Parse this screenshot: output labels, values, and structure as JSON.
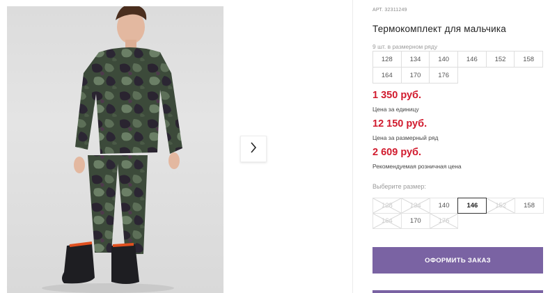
{
  "product": {
    "article": "АРТ. 32311249",
    "title": "Термокомплект для мальчика",
    "series_label": "9 шт. в размерном ряду",
    "series_sizes": [
      "128",
      "134",
      "140",
      "146",
      "152",
      "158",
      "164",
      "170",
      "176"
    ]
  },
  "prices": {
    "unit": {
      "value": "1 350 руб.",
      "note": "Цена за единицу"
    },
    "series": {
      "value": "12 150 руб.",
      "note": "Цена за размерный ряд"
    },
    "retail": {
      "value": "2 609 руб.",
      "note": "Рекомендуемая розничная цена"
    }
  },
  "size_picker": {
    "label": "Выберите размер:",
    "options": [
      {
        "label": "128",
        "available": false,
        "selected": false
      },
      {
        "label": "134",
        "available": false,
        "selected": false
      },
      {
        "label": "140",
        "available": true,
        "selected": false
      },
      {
        "label": "146",
        "available": true,
        "selected": true
      },
      {
        "label": "152",
        "available": false,
        "selected": false
      },
      {
        "label": "158",
        "available": true,
        "selected": false
      },
      {
        "label": "164",
        "available": false,
        "selected": false
      },
      {
        "label": "170",
        "available": true,
        "selected": false
      },
      {
        "label": "176",
        "available": false,
        "selected": false
      }
    ]
  },
  "actions": {
    "order_label": "ОФОРМИТЬ ЗАКАЗ"
  },
  "colors": {
    "price": "#d11b2e",
    "button": "#7a63a3"
  },
  "icons": {
    "next": "chevron-right-icon"
  }
}
